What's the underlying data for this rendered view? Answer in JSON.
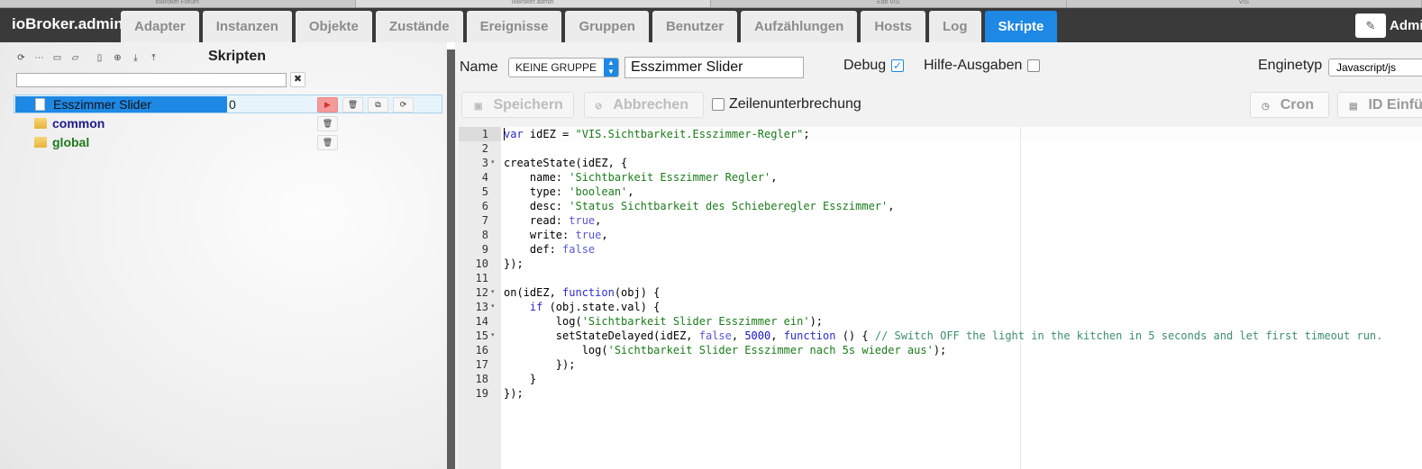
{
  "browser_tabs": [
    "ioBroker Forum",
    "ioBroker.admin",
    "Edit VIS",
    "VIS"
  ],
  "app": {
    "title": "ioBroker.admin"
  },
  "nav": {
    "tabs": [
      "Adapter",
      "Instanzen",
      "Objekte",
      "Zustände",
      "Ereignisse",
      "Gruppen",
      "Benutzer",
      "Aufzählungen",
      "Hosts",
      "Log",
      "Skripte"
    ],
    "active_tab": "Skripte",
    "user_label": "Admin"
  },
  "scripts_panel": {
    "title": "Skripten",
    "filter_value": "",
    "tree": [
      {
        "label": "Esszimmer Slider",
        "count": "0",
        "type": "script"
      },
      {
        "label": "common",
        "type": "folder"
      },
      {
        "label": "global",
        "type": "folder"
      }
    ]
  },
  "editor_header": {
    "name_label": "Name",
    "group_value": "KEINE GRUPPE",
    "name_value": "Esszimmer Slider",
    "debug_label": "Debug",
    "debug_checked": true,
    "help_label": "Hilfe-Ausgaben",
    "help_checked": false,
    "engine_label": "Enginetyp",
    "engine_value": "Javascript/js",
    "save_label": "Speichern",
    "cancel_label": "Abbrechen",
    "wrap_label": "Zeilenunterbrechung",
    "cron_label": "Cron",
    "id_label": "ID Einfügen"
  },
  "code": {
    "language": "javascript",
    "lines": [
      "var idEZ = \"VIS.Sichtbarkeit.Esszimmer-Regler\";",
      "",
      "createState(idEZ, {",
      "    name: 'Sichtbarkeit Esszimmer Regler',",
      "    type: 'boolean',",
      "    desc: 'Status Sichtbarkeit des Schieberegler Esszimmer',",
      "    read: true,",
      "    write: true,",
      "    def: false",
      "});",
      "",
      "on(idEZ, function(obj) {",
      "    if (obj.state.val) {",
      "        log('Sichtbarkeit Slider Esszimmer ein');",
      "        setStateDelayed(idEZ, false, 5000, function () { // Switch OFF the light in the kitchen in 5 seconds and let first timeout run.",
      "            log('Sichtbarkeit Slider Esszimmer nach 5s wieder aus');",
      "        });",
      "    }",
      "});"
    ]
  }
}
